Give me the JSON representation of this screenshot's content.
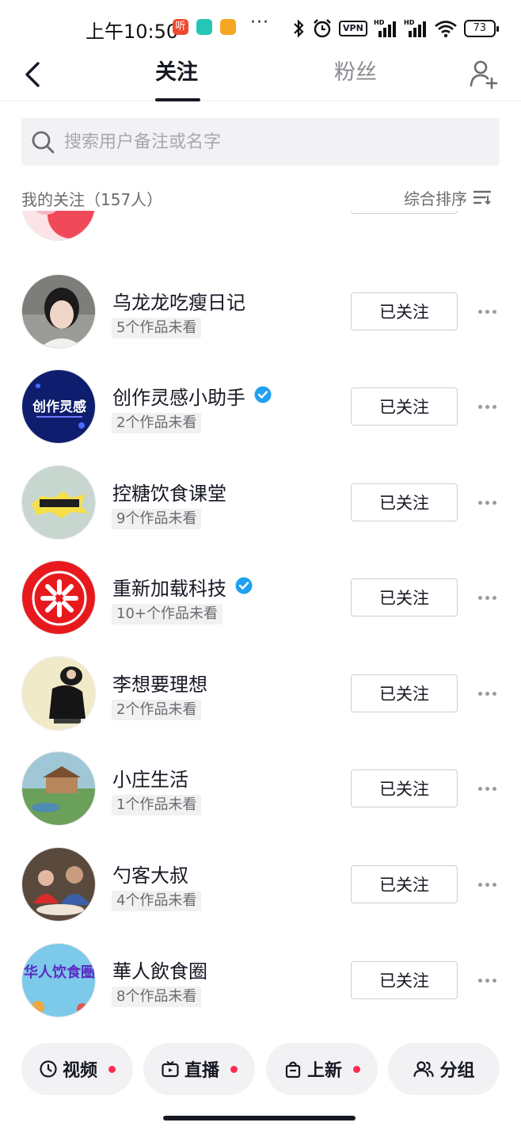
{
  "status_bar": {
    "time": "上午10:50",
    "more": "···",
    "vpn": "VPN",
    "battery": "73",
    "app_badges": [
      {
        "name": "listen-app-icon",
        "color": "#ef4a2f",
        "glyph": "听"
      },
      {
        "name": "message-app-icon",
        "color": "#24c7b6",
        "glyph": ""
      },
      {
        "name": "notes-app-icon",
        "color": "#f5a623",
        "glyph": ""
      }
    ]
  },
  "header": {
    "tab_following": "关注",
    "tab_fans": "粉丝"
  },
  "search": {
    "placeholder": "搜索用户备注或名字"
  },
  "list_header": {
    "title": "我的关注（157人）",
    "sort_label": "综合排序"
  },
  "users": [
    {
      "name": "乌龙龙吃瘦日记",
      "unseen": "5个作品未看",
      "verified": false,
      "button": "已关注"
    },
    {
      "name": "创作灵感小助手",
      "unseen": "2个作品未看",
      "verified": true,
      "button": "已关注",
      "avatar_text": "创作灵感"
    },
    {
      "name": "控糖饮食课堂",
      "unseen": "9个作品未看",
      "verified": false,
      "button": "已关注"
    },
    {
      "name": "重新加载科技",
      "unseen": "10+个作品未看",
      "verified": true,
      "button": "已关注"
    },
    {
      "name": "李想要理想",
      "unseen": "2个作品未看",
      "verified": false,
      "button": "已关注"
    },
    {
      "name": "小庄生活",
      "unseen": "1个作品未看",
      "verified": false,
      "button": "已关注"
    },
    {
      "name": "勺客大叔",
      "unseen": "4个作品未看",
      "verified": false,
      "button": "已关注"
    },
    {
      "name": "華人飲食圈",
      "unseen": "8个作品未看",
      "verified": false,
      "button": "已关注",
      "avatar_text": "华人饮食圈"
    }
  ],
  "filters": [
    {
      "label": "视频",
      "icon": "clock-icon",
      "dot": true
    },
    {
      "label": "直播",
      "icon": "live-tv-icon",
      "dot": true
    },
    {
      "label": "上新",
      "icon": "shopping-bag-icon",
      "dot": true
    },
    {
      "label": "分组",
      "icon": "group-icon",
      "dot": false
    }
  ],
  "colors": {
    "accent_red": "#fe2c55",
    "verified_blue": "#20a0f0",
    "text_primary": "#161823",
    "text_secondary": "#6b6b70"
  }
}
